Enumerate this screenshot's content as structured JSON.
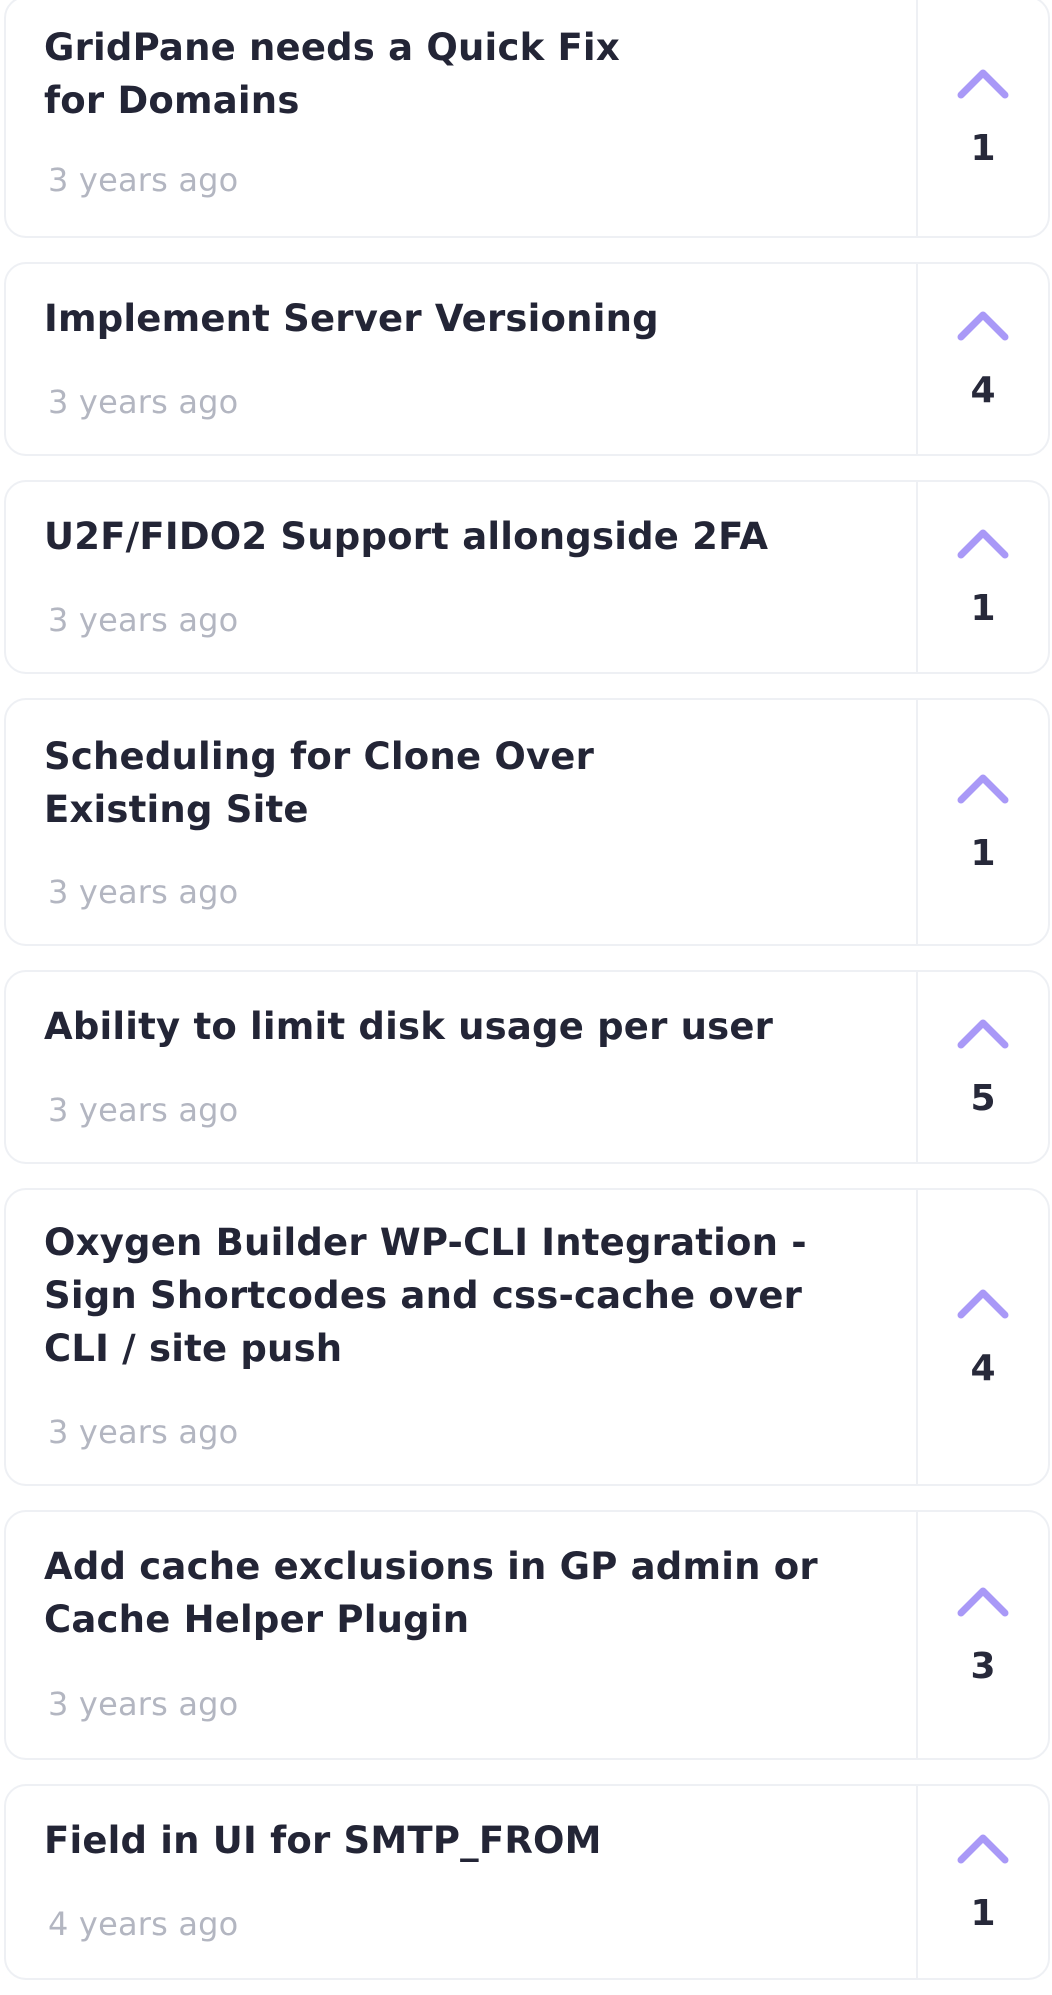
{
  "ideas": [
    {
      "title_lines": [
        "GridPane needs a Quick Fix",
        "for Domains"
      ],
      "age": "3 years ago",
      "votes": "1"
    },
    {
      "title_lines": [
        "Implement Server Versioning"
      ],
      "age": "3 years ago",
      "votes": "4"
    },
    {
      "title_lines": [
        "U2F/FIDO2 Support allongside 2FA"
      ],
      "age": "3 years ago",
      "votes": "1"
    },
    {
      "title_lines": [
        "Scheduling for Clone Over",
        "Existing Site"
      ],
      "age": "3 years ago",
      "votes": "1"
    },
    {
      "title_lines": [
        "Ability to limit disk usage per user"
      ],
      "age": "3 years ago",
      "votes": "5"
    },
    {
      "title_lines": [
        "Oxygen Builder WP-CLI Integration -",
        "Sign Shortcodes and css-cache over",
        "CLI / site push"
      ],
      "age": "3 years ago",
      "votes": "4"
    },
    {
      "title_lines": [
        "Add cache exclusions in GP admin or",
        "Cache Helper Plugin"
      ],
      "age": "3 years ago",
      "votes": "3"
    },
    {
      "title_lines": [
        "Field in UI for SMTP_FROM"
      ],
      "age": "4 years ago",
      "votes": "1"
    }
  ],
  "colors": {
    "upvote_icon": "#a999f7",
    "title_text": "#232536",
    "date_text": "#b3b6c1",
    "card_border": "#eef0f4"
  },
  "icons": {
    "upvote": "chevron-up-icon"
  }
}
